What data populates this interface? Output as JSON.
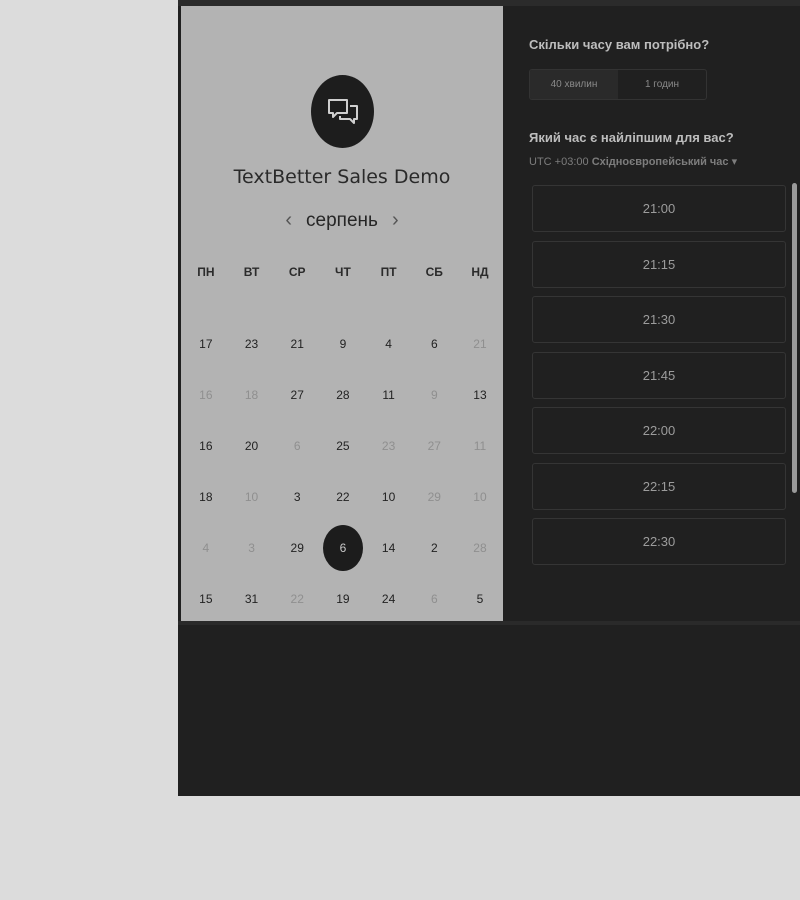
{
  "event": {
    "title": "TextBetter Sales Demo"
  },
  "calendar": {
    "month": "серпень",
    "prev_arrow": "‹",
    "next_arrow": "›",
    "weekdays": [
      "ПН",
      "ВТ",
      "СР",
      "ЧТ",
      "ПТ",
      "СБ",
      "НД"
    ],
    "weeks": [
      [
        {
          "d": "17",
          "m": false
        },
        {
          "d": "23",
          "m": false
        },
        {
          "d": "21",
          "m": false
        },
        {
          "d": "9",
          "m": false
        },
        {
          "d": "4",
          "m": false
        },
        {
          "d": "6",
          "m": false
        },
        {
          "d": "21",
          "m": true
        }
      ],
      [
        {
          "d": "16",
          "m": true
        },
        {
          "d": "18",
          "m": true
        },
        {
          "d": "27",
          "m": false
        },
        {
          "d": "28",
          "m": false
        },
        {
          "d": "11",
          "m": false
        },
        {
          "d": "9",
          "m": true
        },
        {
          "d": "13",
          "m": false
        }
      ],
      [
        {
          "d": "16",
          "m": false
        },
        {
          "d": "20",
          "m": false
        },
        {
          "d": "6",
          "m": true
        },
        {
          "d": "25",
          "m": false
        },
        {
          "d": "23",
          "m": true
        },
        {
          "d": "27",
          "m": true
        },
        {
          "d": "11",
          "m": true
        }
      ],
      [
        {
          "d": "18",
          "m": false
        },
        {
          "d": "10",
          "m": true
        },
        {
          "d": "3",
          "m": false
        },
        {
          "d": "22",
          "m": false
        },
        {
          "d": "10",
          "m": false
        },
        {
          "d": "29",
          "m": true
        },
        {
          "d": "10",
          "m": true
        }
      ],
      [
        {
          "d": "4",
          "m": true
        },
        {
          "d": "3",
          "m": true
        },
        {
          "d": "29",
          "m": false
        },
        {
          "d": "6",
          "m": false,
          "sel": true
        },
        {
          "d": "14",
          "m": false
        },
        {
          "d": "2",
          "m": false
        },
        {
          "d": "28",
          "m": true
        }
      ],
      [
        {
          "d": "15",
          "m": false
        },
        {
          "d": "31",
          "m": false
        },
        {
          "d": "22",
          "m": true
        },
        {
          "d": "19",
          "m": false
        },
        {
          "d": "24",
          "m": false
        },
        {
          "d": "6",
          "m": true
        },
        {
          "d": "5",
          "m": false
        }
      ]
    ]
  },
  "duration": {
    "question": "Скільки часу вам потрібно?",
    "options": [
      "40 хвилин",
      "1 годин"
    ],
    "selected_index": 0
  },
  "time": {
    "question": "Який час є найліпшим для вас?",
    "timezone_prefix": "UTC +03:00",
    "timezone_name": "Східноєвропейський час",
    "dropdown_icon": "▾",
    "slots": [
      "21:00",
      "21:15",
      "21:30",
      "21:45",
      "22:00",
      "22:15",
      "22:30",
      ""
    ]
  },
  "icons": {
    "logo": "chat-bubbles-icon"
  },
  "colors": {
    "panel": "#b3b3b3",
    "background": "#202020",
    "selected": "#1c1c1c"
  }
}
